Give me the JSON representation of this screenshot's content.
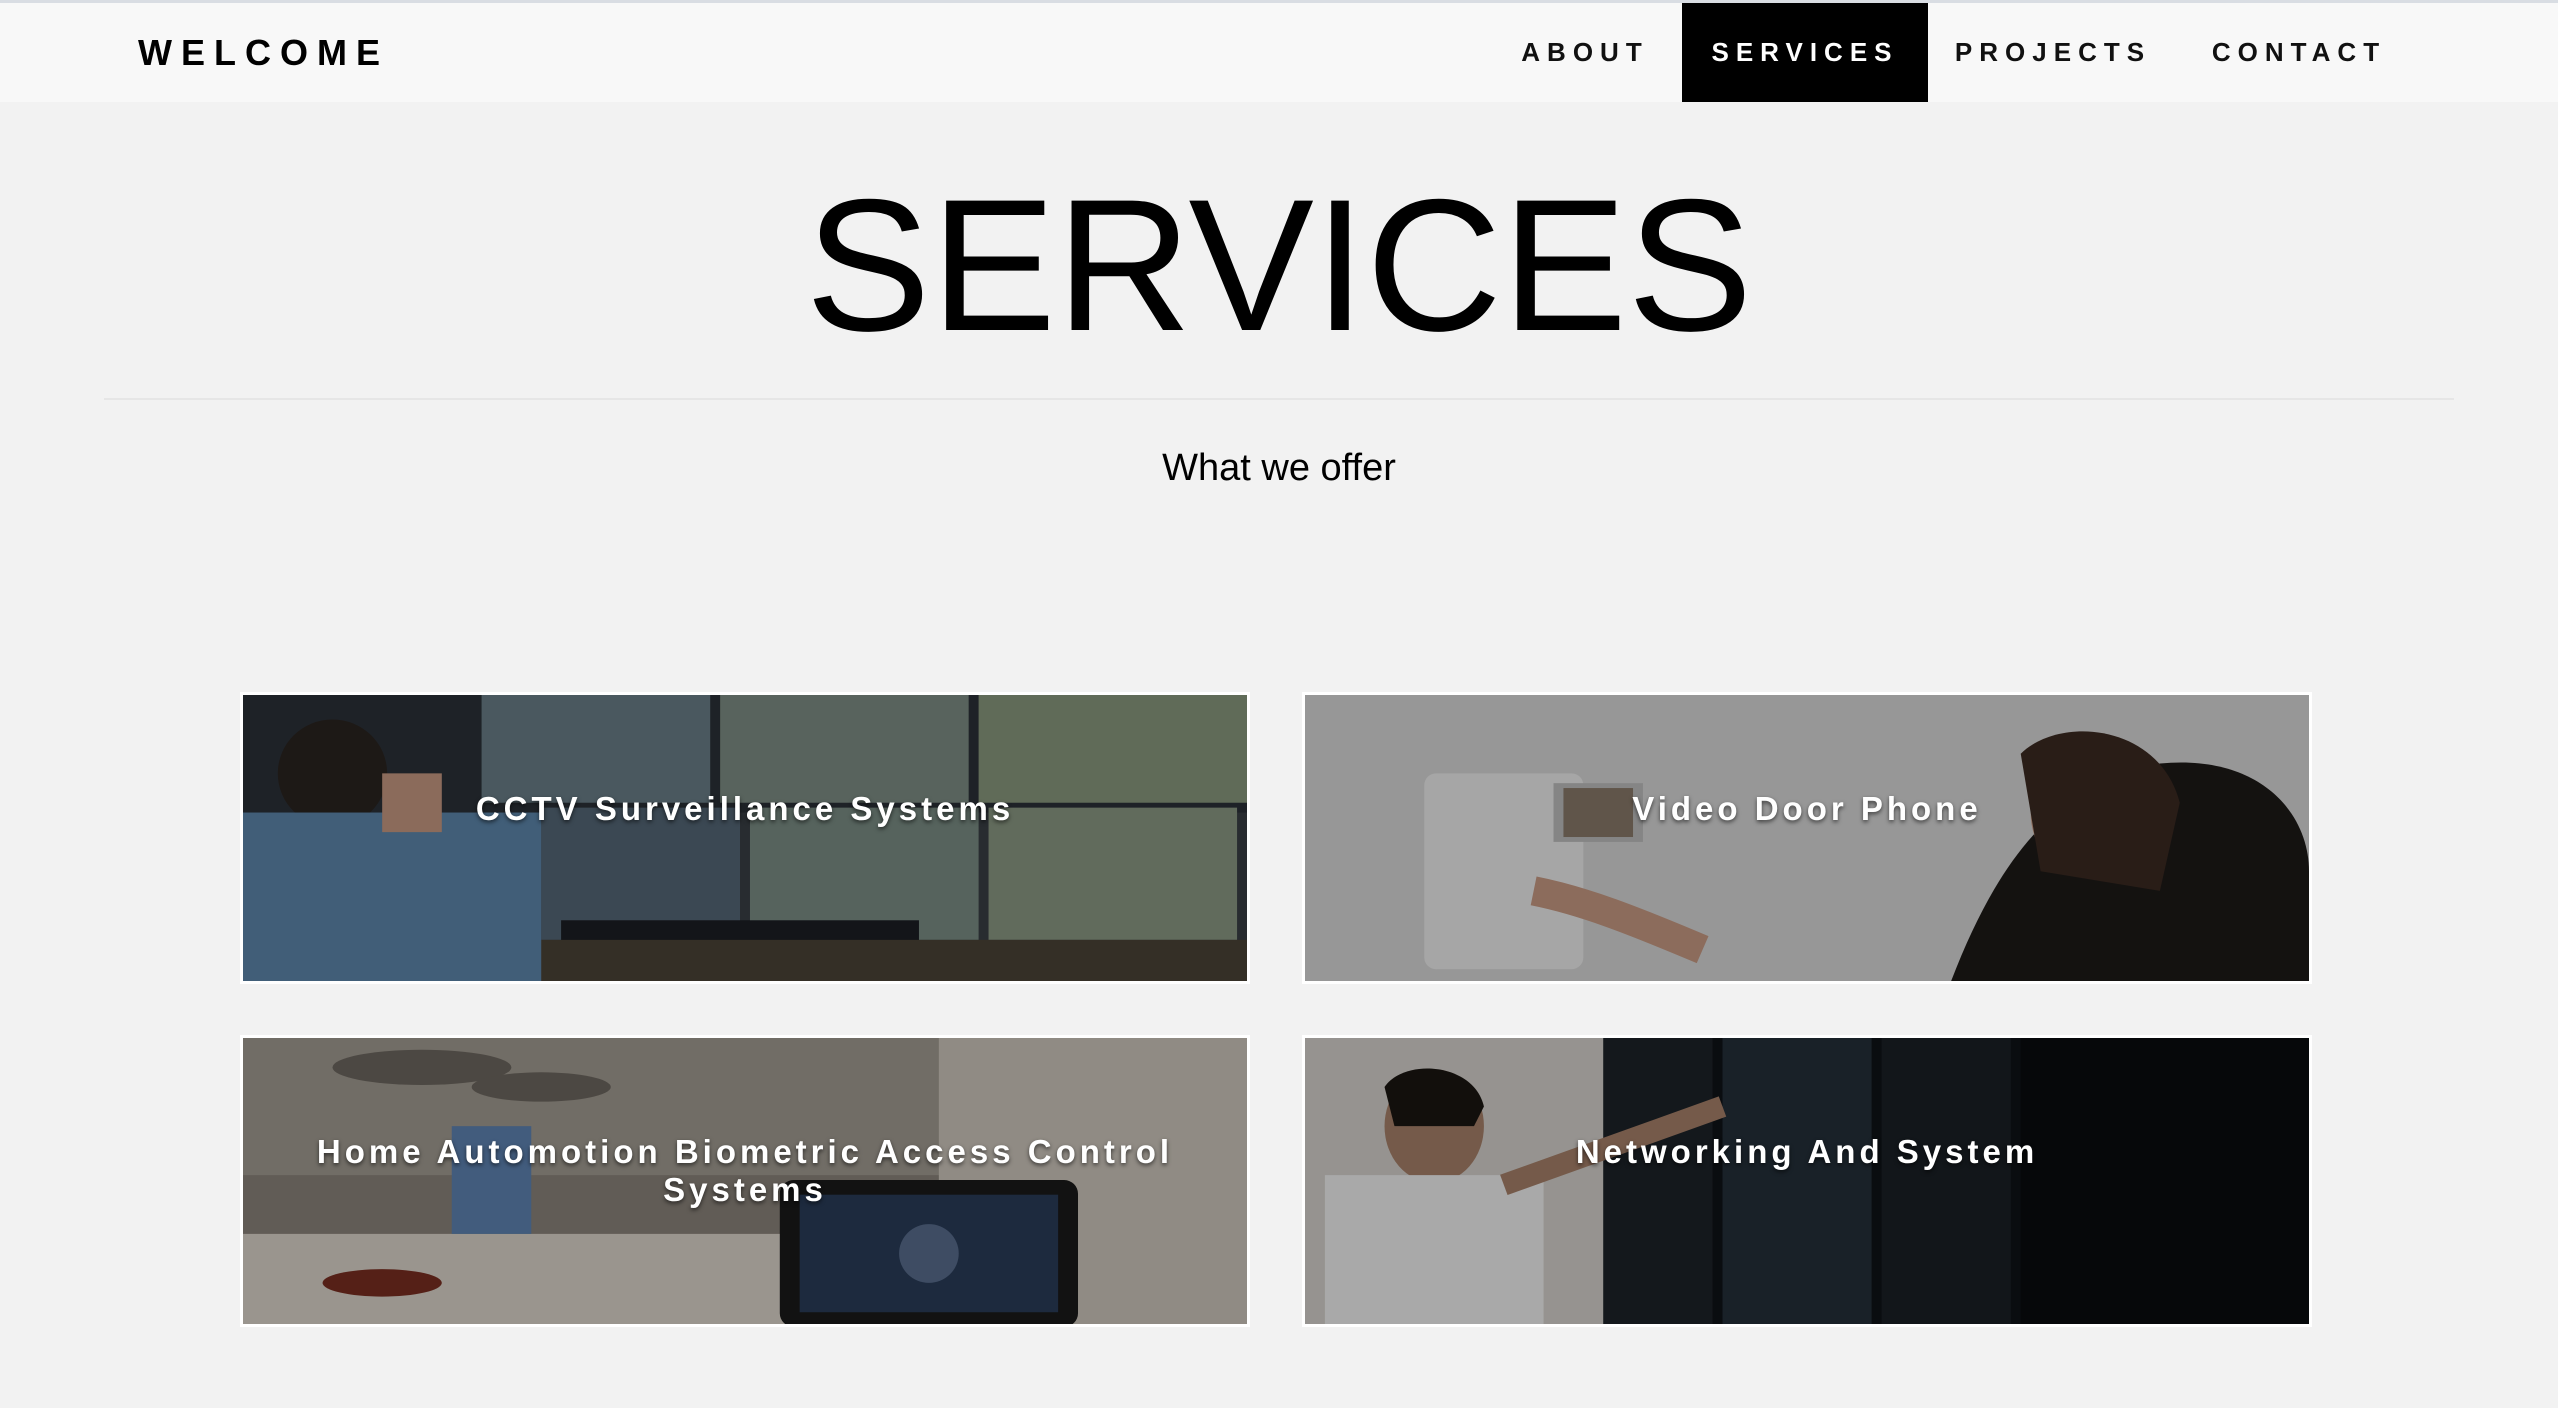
{
  "nav": {
    "brand": "WELCOME",
    "items": [
      {
        "label": "ABOUT",
        "active": false
      },
      {
        "label": "SERVICES",
        "active": true
      },
      {
        "label": "PROJECTS",
        "active": false
      },
      {
        "label": "CONTACT",
        "active": false
      }
    ]
  },
  "header": {
    "title": "SERVICES",
    "subtitle": "What we offer"
  },
  "services": [
    {
      "title": "CCTV Surveillance Systems"
    },
    {
      "title": "Video Door Phone"
    },
    {
      "title": "Home Automotion Biometric Access Control Systems"
    },
    {
      "title": "Networking And System"
    }
  ],
  "colors": {
    "page_background": "#f2f2f2",
    "navbar_background": "#f8f8f8",
    "active_nav_background": "#000000",
    "active_nav_text": "#ffffff",
    "text": "#000000"
  }
}
